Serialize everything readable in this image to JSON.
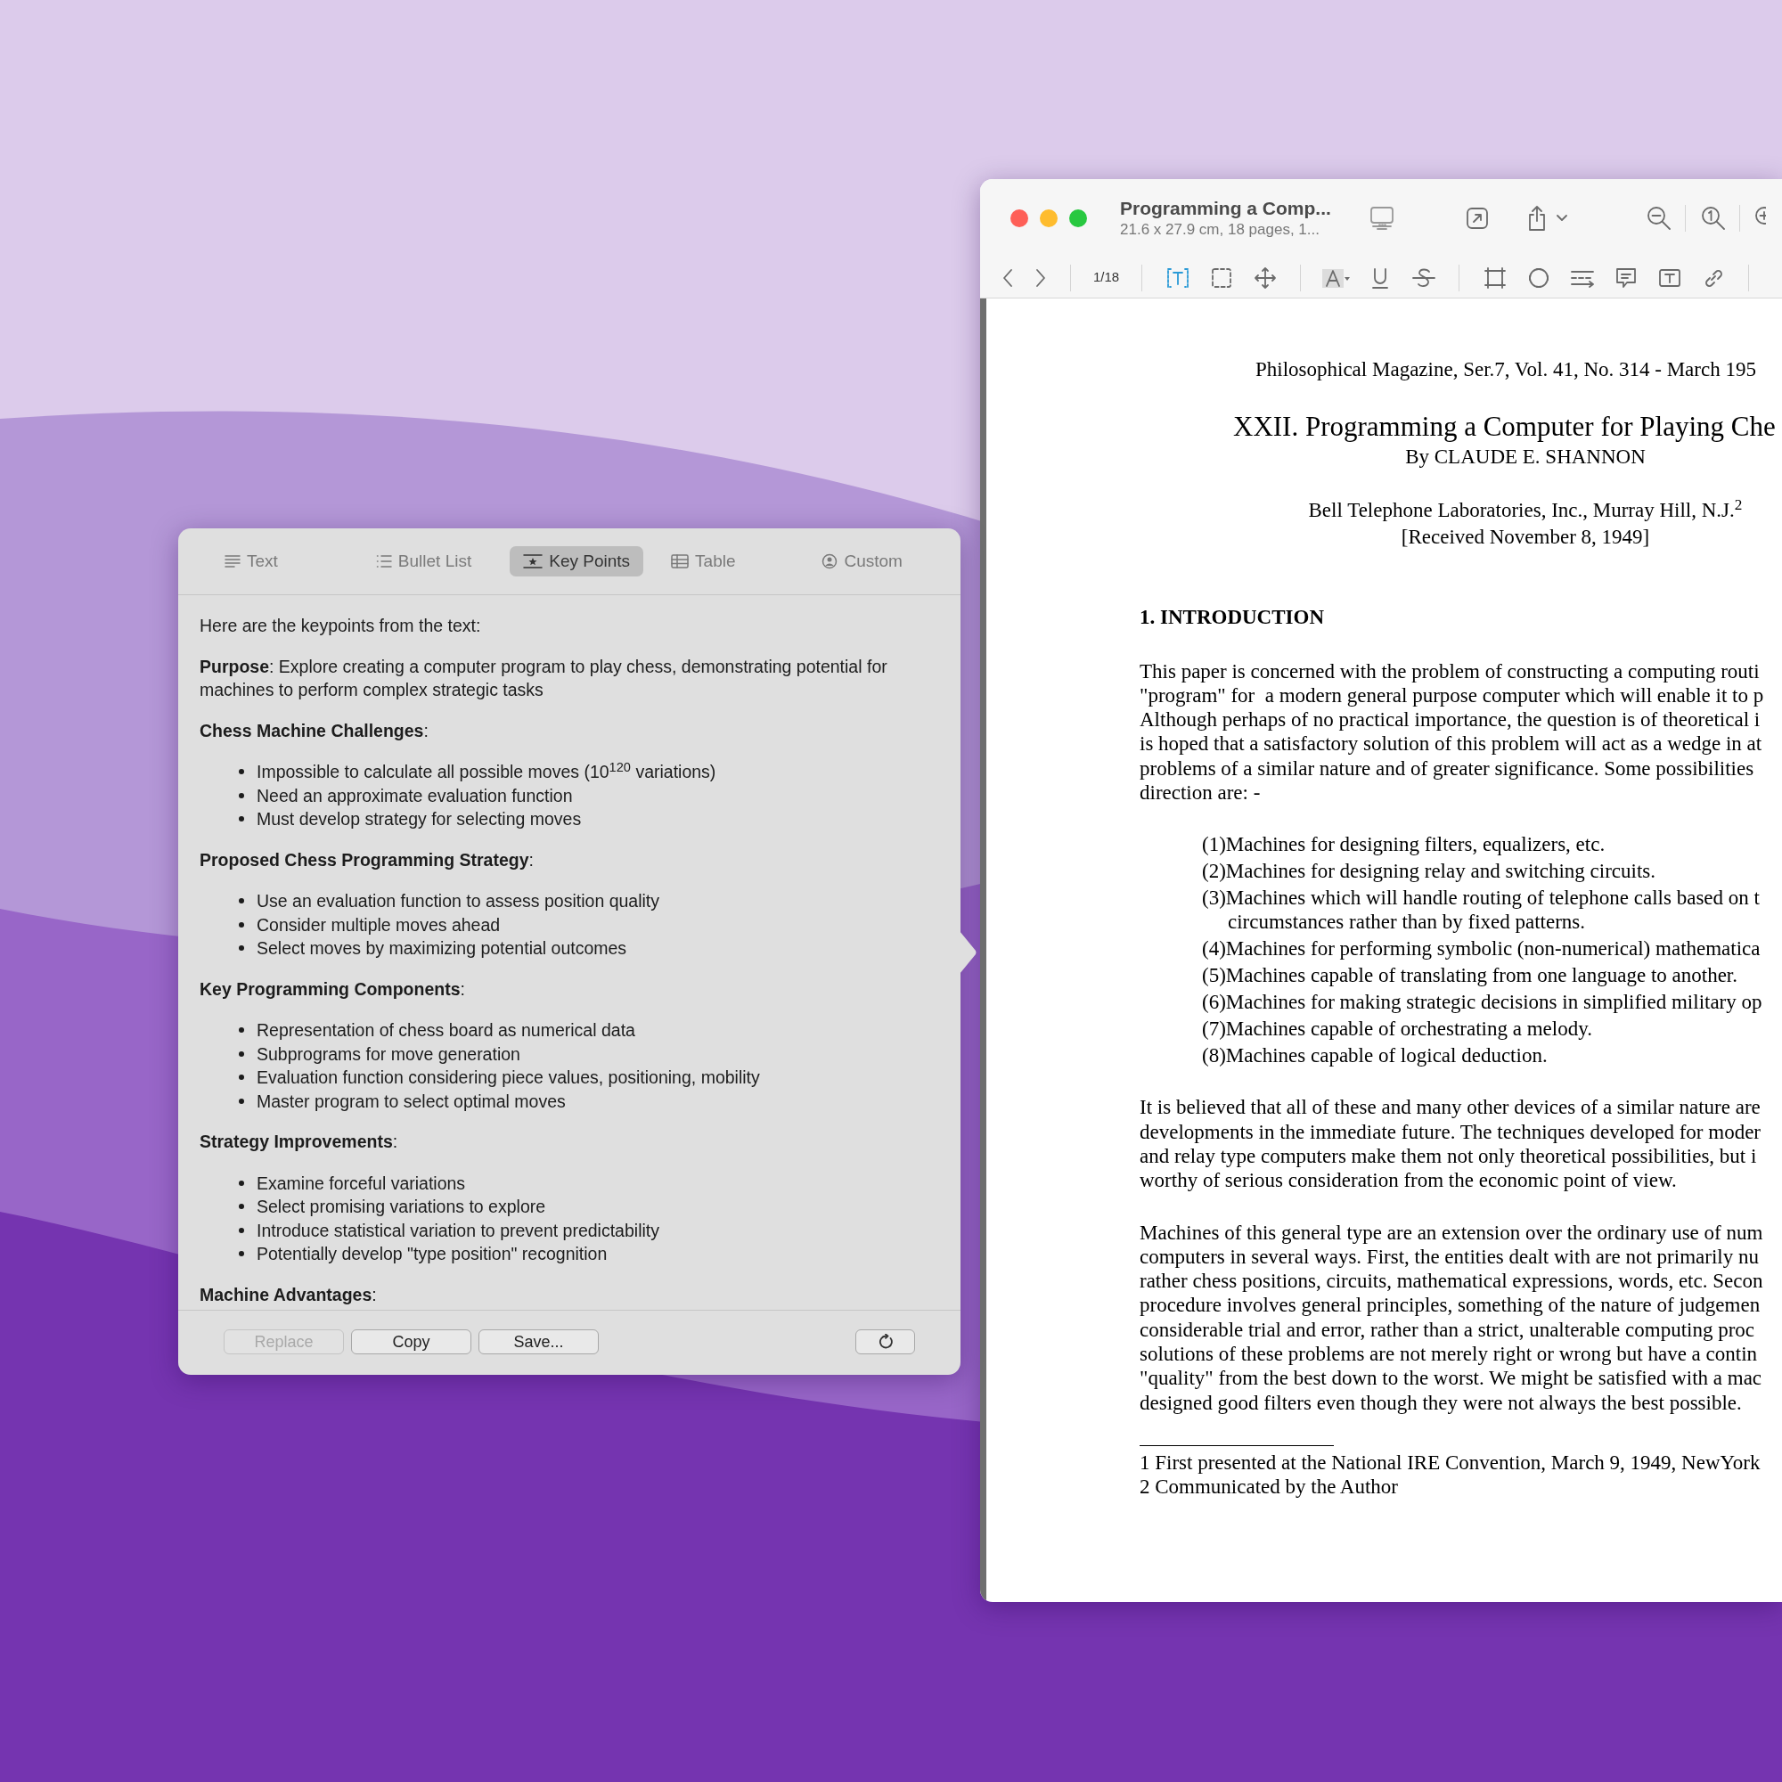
{
  "pdf_window": {
    "title": "Programming a Comp...",
    "subtitle": "21.6 x 27.9 cm, 18 pages, 1...",
    "page_indicator": "1/18",
    "selection_tools": [
      {
        "selected": true
      },
      {
        "selected": false
      },
      {
        "selected": false
      }
    ],
    "document": {
      "header": "Philosophical Magazine, Ser.7, Vol. 41, No. 314 - March 195",
      "title": "XXII. Programming a Computer for Playing Che",
      "byline": "By CLAUDE E. SHANNON",
      "affiliation": "Bell Telephone Laboratories, Inc., Murray Hill, N.J.$^{2}$",
      "received": "[Received November 8, 1949]",
      "heading": "1. INTRODUCTION",
      "intro_paragraph": "This paper is concerned with the problem of constructing a computing routi\n\"program\" for  a modern general purpose computer which will enable it to p\nAlthough perhaps of no practical importance, the question is of theoretical i\nis hoped that a satisfactory solution of this problem will act as a wedge in at\nproblems of a similar nature and of greater significance. Some possibilities\ndirection are: -",
      "list_items": [
        "(1)Machines for designing filters, equalizers, etc.",
        "(2)Machines for designing relay and switching circuits.",
        "(3)Machines which will handle routing of telephone calls based on t\ncircumstances rather than by fixed patterns.",
        "(4)Machines for performing symbolic (non-numerical) mathematica",
        "(5)Machines capable of translating from one language to another.",
        "(6)Machines for making strategic decisions in simplified military op",
        "(7)Machines capable of orchestrating a melody.",
        "(8)Machines capable of logical deduction."
      ],
      "paragraphs": [
        "It is believed that all of these and many other devices of a similar nature are\ndevelopments in the immediate future. The techniques developed for moder\nand relay type computers make them not only theoretical possibilities, but i\nworthy of serious consideration from the economic point of view.",
        "Machines of this general type are an extension over the ordinary use of num\ncomputers in several ways. First, the entities dealt with are not primarily nu\nrather chess positions, circuits, mathematical expressions, words, etc. Secon\nprocedure involves general principles, something of the nature of judgemen\nconsiderable trial and error, rather than a strict, unalterable computing proc\nsolutions of these problems are not merely right or wrong but have a contin\n\"quality\" from the best down to the worst. We might be satisfied with a mac\ndesigned good filters even though they were not always the best possible."
      ],
      "footnotes": [
        "1 First presented at the National IRE Convention, March 9, 1949, NewYork",
        "2 Communicated by the Author"
      ]
    }
  },
  "summary_popover": {
    "tabs": [
      {
        "label": "Text",
        "selected": false
      },
      {
        "label": "Bullet List",
        "selected": false
      },
      {
        "label": "Key Points",
        "selected": true
      },
      {
        "label": "Table",
        "selected": false
      },
      {
        "label": "Custom",
        "selected": false
      }
    ],
    "intro": "Here are the keypoints from the text:",
    "sections": [
      {
        "kind": "paragraph",
        "text": "**Purpose**: Explore creating a computer program to play chess, demonstrating potential for machines to perform complex strategic tasks"
      },
      {
        "kind": "list",
        "heading": "**Chess Machine Challenges**:",
        "bullets": [
          "Impossible to calculate all possible moves (10$^{120}$ variations)",
          "Need an approximate evaluation function",
          "Must develop strategy for selecting moves"
        ]
      },
      {
        "kind": "list",
        "heading": "**Proposed Chess Programming Strategy**:",
        "bullets": [
          "Use an evaluation function to assess position quality",
          "Consider multiple moves ahead",
          "Select moves by maximizing potential outcomes"
        ]
      },
      {
        "kind": "list",
        "heading": "**Key Programming Components**:",
        "bullets": [
          "Representation of chess board as numerical data",
          "Subprograms for move generation",
          "Evaluation function considering piece values, positioning, mobility",
          "Master program to select optimal moves"
        ]
      },
      {
        "kind": "list",
        "heading": "**Strategy Improvements**:",
        "bullets": [
          "Examine forceful variations",
          "Select promising variations to explore",
          "Introduce statistical variation to prevent predictability",
          "Potentially develop \"type position\" recognition"
        ]
      },
      {
        "kind": "heading",
        "text": "**Machine Advantages**:"
      }
    ],
    "buttons": [
      {
        "label": "Replace",
        "disabled": true
      },
      {
        "label": "Copy",
        "disabled": false
      },
      {
        "label": "Save...",
        "disabled": false
      }
    ]
  }
}
